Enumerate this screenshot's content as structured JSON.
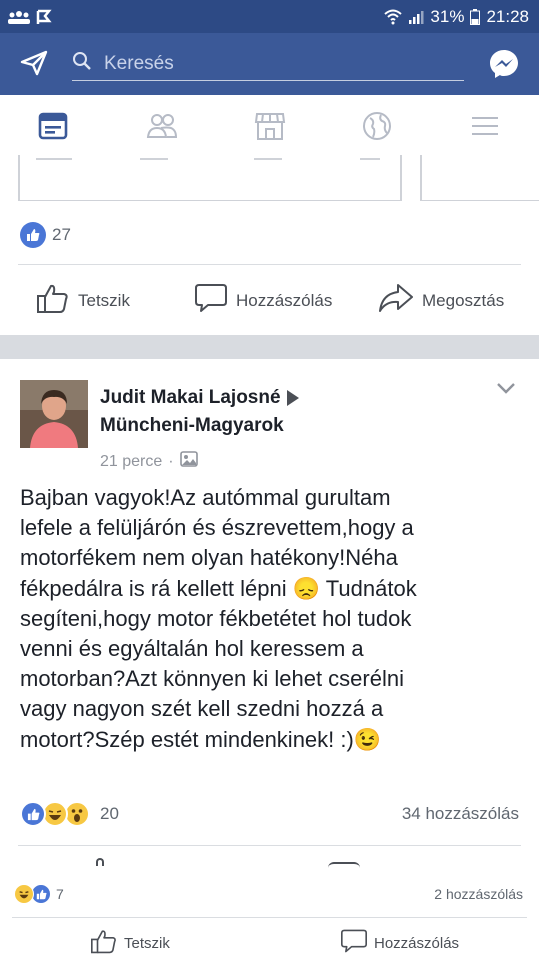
{
  "status_bar": {
    "battery": "31%",
    "time": "21:28"
  },
  "header": {
    "search_placeholder": "Keresés"
  },
  "tabs": [
    {
      "name": "news-feed",
      "icon": "news-feed-icon",
      "active": true
    },
    {
      "name": "friends",
      "icon": "friends-icon",
      "active": false
    },
    {
      "name": "marketplace",
      "icon": "marketplace-icon",
      "active": false
    },
    {
      "name": "notifications",
      "icon": "globe-icon",
      "active": false
    },
    {
      "name": "menu",
      "icon": "menu-icon",
      "active": false
    }
  ],
  "previous_post": {
    "like_count": "27",
    "actions": {
      "like": "Tetszik",
      "comment": "Hozzászólás",
      "share": "Megosztás"
    }
  },
  "post": {
    "author": "Judit Makai Lajosné",
    "group": "Müncheni-Magyarok",
    "time": "21 perce",
    "text_lines": [
      "Bajban vagyok!Az autómmal gurultam",
      "lefele a felüljárón és észrevettem,hogy a",
      "motorfékem nem olyan hatékony!Néha",
      "fékpedálra is rá kellett lépni 😞 Tudnátok",
      "segíteni,hogy motor fékbetétet hol tudok",
      "venni és egyáltalán hol keressem a",
      "motorban?Azt könnyen ki lehet cserélni",
      "vagy nagyon szét kell szedni hozzá a",
      "motort?Szép estét mindenkinek! :)😉"
    ],
    "reaction_count": "20",
    "comment_count": "34 hozzászólás"
  },
  "next_post": {
    "reaction_count": "7",
    "comment_count": "2 hozzászólás",
    "actions": {
      "like": "Tetszik",
      "comment": "Hozzászólás"
    }
  },
  "colors": {
    "brand_blue": "#3b5998",
    "status_bar": "#2d4a85",
    "like_blue": "#4a76d6",
    "haha_yellow": "#f7c843"
  }
}
